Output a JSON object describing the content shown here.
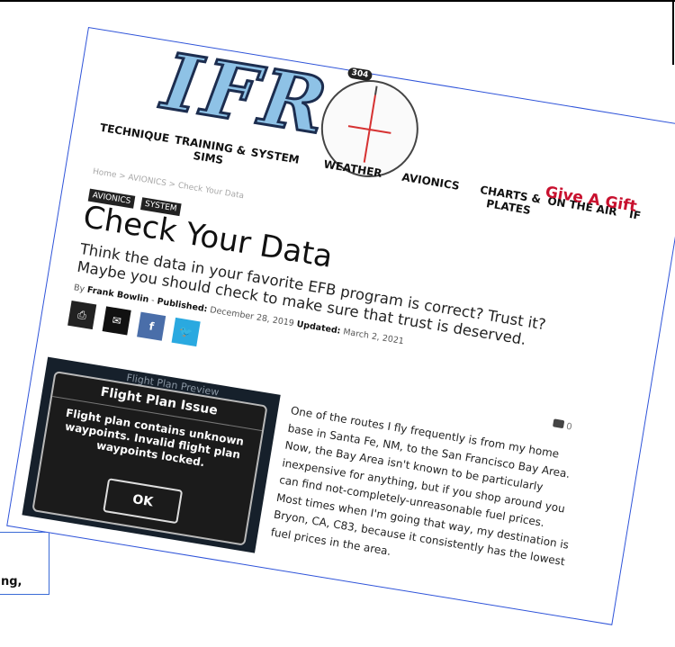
{
  "logo": {
    "text": "IFR",
    "badge": "304"
  },
  "nav": {
    "items": [
      "TECHNIQUE",
      "TRAINING &\nSIMS",
      "SYSTEM",
      "WEATHER",
      "AVIONICS",
      "CHARTS &\nPLATES",
      "ON THE AIR",
      "IF"
    ],
    "gift": "Give A Gift"
  },
  "breadcrumb": "Home > AVIONICS > Check Your Data",
  "tags": [
    "AVIONICS",
    "SYSTEM"
  ],
  "article": {
    "title": "Check Your Data",
    "subtitle": "Think the data in your favorite EFB program is correct? Trust it? Maybe you should check to make sure that trust is deserved.",
    "by_prefix": "By",
    "author": "Frank Bowlin",
    "published_label": "Published:",
    "published": "December 28, 2019",
    "updated_label": "Updated:",
    "updated": "March 2, 2021",
    "comment_count": "0",
    "body": "One of the routes I fly frequently is from my home base in Santa Fe, NM, to the San Francisco Bay Area. Now, the Bay Area isn't known to be particularly inexpensive for anything, but if you shop around you can find not-completely-unreasonable fuel prices. Most times when I'm going that way, my destination is Bryon, CA, C83, because it consistently has the lowest fuel prices in the area."
  },
  "share": {
    "icons": [
      "print-icon",
      "mail-icon",
      "facebook-icon",
      "twitter-icon"
    ]
  },
  "dialog": {
    "backdrop_title": "Flight Plan Preview",
    "title": "Flight Plan Issue",
    "message": "Flight plan contains unknown waypoints. Invalid flight plan waypoints locked.",
    "ok": "OK"
  },
  "caption": {
    "text": "ng,"
  },
  "colors": {
    "gift": "#c8102e",
    "border": "#2e53d9",
    "facebook": "#4a6ea9",
    "twitter": "#2aa9e0"
  }
}
